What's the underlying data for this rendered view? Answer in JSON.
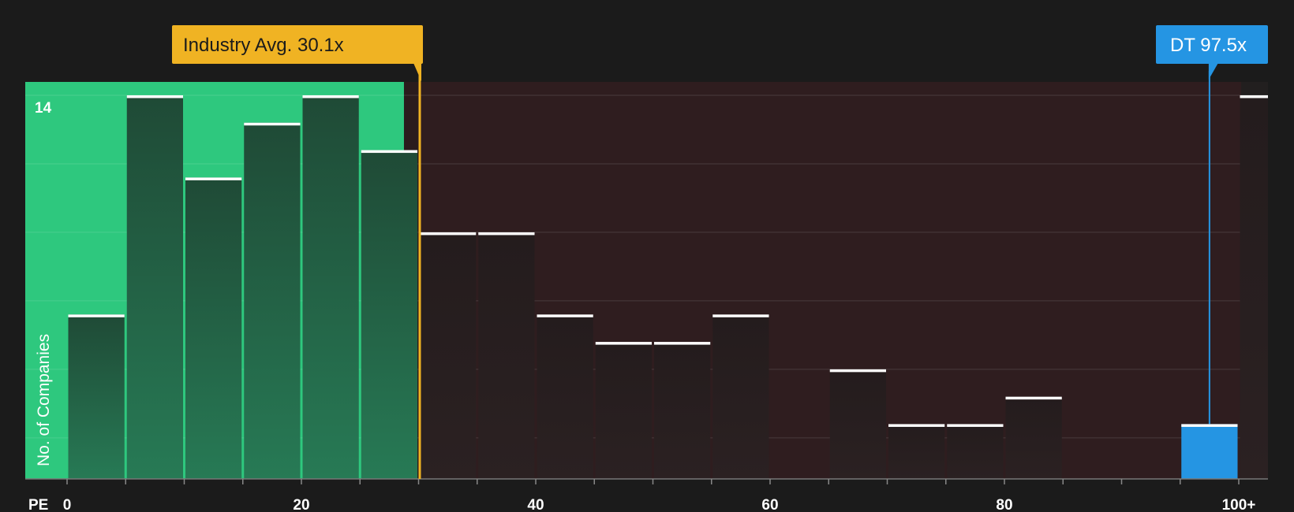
{
  "chart_data": {
    "type": "bar",
    "xlabel": "PE",
    "ylabel": "No. of Companies",
    "bin_width": 5,
    "x_ticks": [
      {
        "value": 0,
        "label": "0"
      },
      {
        "value": 20,
        "label": "20"
      },
      {
        "value": 40,
        "label": "40"
      },
      {
        "value": 60,
        "label": "60"
      },
      {
        "value": 80,
        "label": "80"
      },
      {
        "value": 100,
        "label": "100+"
      }
    ],
    "y_tick_label": {
      "value": 14,
      "label": "14"
    },
    "ylim": [
      0,
      14
    ],
    "bins": [
      {
        "x": 0,
        "count": 6
      },
      {
        "x": 5,
        "count": 14
      },
      {
        "x": 10,
        "count": 11
      },
      {
        "x": 15,
        "count": 13
      },
      {
        "x": 20,
        "count": 14
      },
      {
        "x": 25,
        "count": 12
      },
      {
        "x": 30,
        "count": 9
      },
      {
        "x": 35,
        "count": 9
      },
      {
        "x": 40,
        "count": 6
      },
      {
        "x": 45,
        "count": 5
      },
      {
        "x": 50,
        "count": 5
      },
      {
        "x": 55,
        "count": 6
      },
      {
        "x": 60,
        "count": 0
      },
      {
        "x": 65,
        "count": 4
      },
      {
        "x": 70,
        "count": 2
      },
      {
        "x": 75,
        "count": 2
      },
      {
        "x": 80,
        "count": 3
      },
      {
        "x": 85,
        "count": 0
      },
      {
        "x": 90,
        "count": 0
      },
      {
        "x": 95,
        "count": 2
      },
      {
        "x": 100,
        "count": 14
      }
    ],
    "industry_average": {
      "value": 30.1,
      "label": "Industry Avg. 30.1x"
    },
    "company": {
      "value": 97.5,
      "label": "DT 97.5x"
    },
    "colors": {
      "background": "#1b1b1b",
      "below_average_zone": "#2ec87e",
      "above_average_zone": "#2f1d1f",
      "industry_marker": "#f0b323",
      "company_marker": "#2595e3",
      "bar_cap": "#ffffff"
    }
  }
}
